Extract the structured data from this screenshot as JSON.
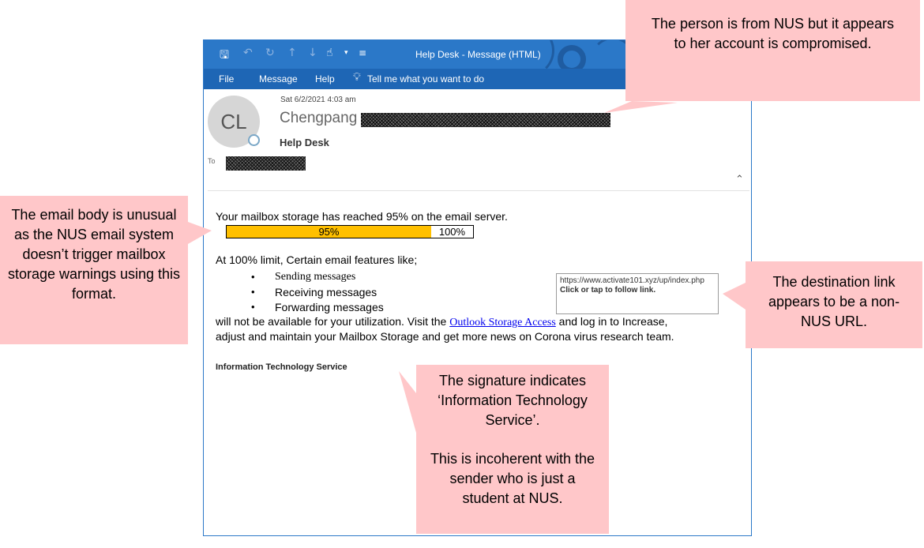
{
  "window": {
    "title": "Help Desk  -  Message (HTML)",
    "menu": [
      "File",
      "Message",
      "Help"
    ],
    "tell_me": "Tell me what you want to do"
  },
  "message": {
    "date": "Sat 6/2/2021 4:03 am",
    "avatar_initials": "CL",
    "sender": "Chengpang",
    "subject": "Help Desk",
    "to_label": "To"
  },
  "body": {
    "line1": "Your mailbox storage has reached 95% on the email server.",
    "storage_fraction": 0.83,
    "bar_fill_label": "95%",
    "bar_rest_label": "100%",
    "line2": "At 100% limit, Certain email features like;",
    "features": [
      "Sending messages",
      "Receiving messages",
      "Forwarding messages"
    ],
    "para_a": "will not be available for your utilization. Visit the ",
    "link_text": "Outlook Storage Access",
    "para_b": " and log in to Increase,",
    "para_c": "adjust and maintain your Mailbox Storage and get more news on Corona virus research team.",
    "signature": "Information Technology Service"
  },
  "tooltip": {
    "url": "https://www.activate101.xyz/up/index.php",
    "hint": "Click or tap to follow link."
  },
  "callouts": {
    "top_right": "The person is from NUS but it appears to her account is compromised.",
    "left": "The email body is unusual as the NUS email system doesn’t trigger mailbox storage warnings using this format.",
    "right": "The destination link appears to be a non-NUS URL.",
    "bottom_a": "The signature indicates ‘Information Technology Service’.",
    "bottom_b": "This is incoherent with the sender who is just a student at NUS."
  },
  "colors": {
    "titlebar": "#2b78c8",
    "menubar": "#1e66b5",
    "storage_bar": "#ffc000",
    "callout": "#ffc7c9"
  }
}
